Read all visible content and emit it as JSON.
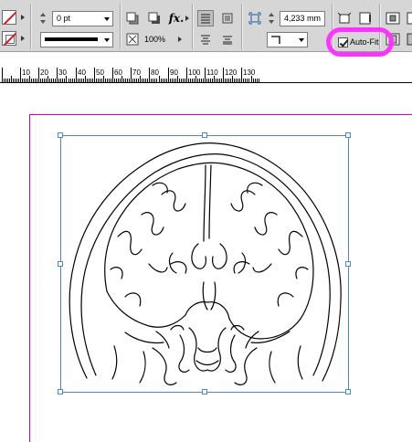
{
  "control_panel": {
    "stroke_weight": "0 pt",
    "zoom_percent": "100%",
    "offset_value": "4,233 mm",
    "autofit_label": "Auto-Fit",
    "autofit_checked": true,
    "highlight_color": "#ff33ff"
  },
  "ruler": {
    "labels": [
      "10",
      "20",
      "30",
      "40",
      "50",
      "60",
      "70",
      "80",
      "90",
      "100",
      "110",
      "120",
      "130"
    ]
  },
  "canvas": {
    "page_edge_color": "#c200c2",
    "frame_color": "#4f87c9",
    "image_icon": "brain-ct-line-art"
  }
}
